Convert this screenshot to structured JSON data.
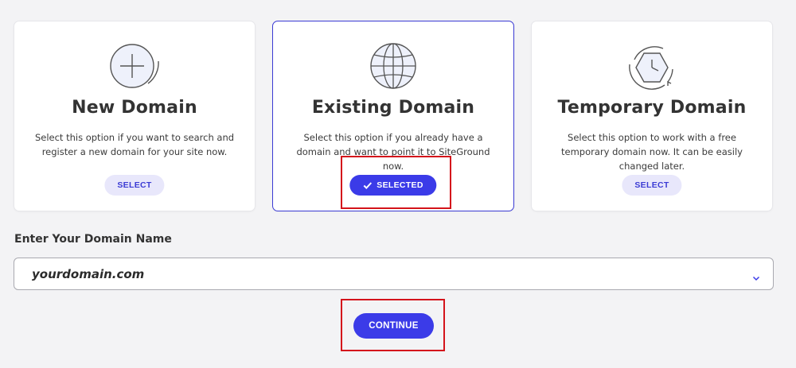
{
  "options": [
    {
      "title": "New Domain",
      "description": "Select this option if you want to search and register a new domain for your site now.",
      "button_label": "SELECT",
      "icon": "plus-circle-icon",
      "selected": false
    },
    {
      "title": "Existing Domain",
      "description": "Select this option if you already have a domain and want to point it to SiteGround now.",
      "button_label": "SELECTED",
      "icon": "globe-icon",
      "selected": true
    },
    {
      "title": "Temporary Domain",
      "description": "Select this option to work with a free temporary domain now. It can be easily changed later.",
      "button_label": "SELECT",
      "icon": "clock-icon",
      "selected": false
    }
  ],
  "domain_field": {
    "label": "Enter Your Domain Name",
    "value": "yourdomain.com"
  },
  "continue_label": "CONTINUE",
  "colors": {
    "accent": "#3b3be8",
    "accent_light": "#e8e7fb",
    "highlight": "#d4131b",
    "background": "#f3f3f5"
  }
}
